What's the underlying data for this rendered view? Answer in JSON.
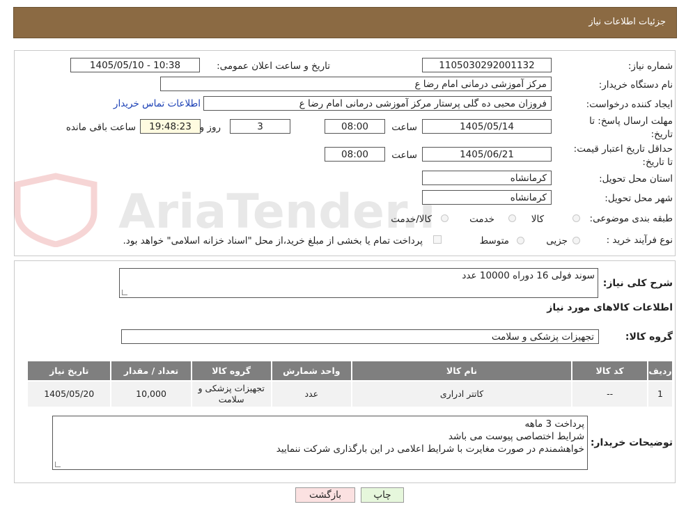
{
  "header": {
    "title": "جزئیات اطلاعات نیاز"
  },
  "form": {
    "need_number_label": "شماره نیاز:",
    "need_number": "1105030292001132",
    "announce_label": "تاریخ و ساعت اعلان عمومی:",
    "announce_value": "1405/05/10 - 10:38",
    "buyer_org_label": "نام دستگاه خریدار:",
    "buyer_org": "مرکز آموزشی  درمانی امام رضا  ع",
    "requester_label": "ایجاد کننده درخواست:",
    "requester": "فروزان محبی ده گلی پرستار مرکز آموزشی  درمانی امام رضا  ع",
    "contact_link": "اطلاعات تماس خریدار",
    "deadline_label": "مهلت ارسال پاسخ: تا تاریخ:",
    "deadline_date": "1405/05/14",
    "time_label": "ساعت",
    "deadline_time": "08:00",
    "days_value": "3",
    "days_label": "روز و",
    "remaining_time": "19:48:23",
    "remaining_label": "ساعت باقی مانده",
    "validity_label": "حداقل تاریخ اعتبار قیمت: تا تاریخ:",
    "validity_date": "1405/06/21",
    "validity_time": "08:00",
    "province_label": "استان محل تحویل:",
    "province": "کرمانشاه",
    "city_label": "شهر محل تحویل:",
    "city": "کرمانشاه",
    "category_label": "طبقه بندی موضوعی:",
    "category_options": [
      "کالا",
      "خدمت",
      "کالا/خدمت"
    ],
    "process_label": "نوع فرآیند خرید :",
    "process_options": [
      "جزیی",
      "متوسط"
    ],
    "payment_note": "پرداخت تمام یا بخشی از مبلغ خرید،از محل \"اسناد خزانه اسلامی\" خواهد بود."
  },
  "summary": {
    "description_label": "شرح کلی نیاز:",
    "description": "سوند فولی 16 دوراه 10000 عدد",
    "goods_info_title": "اطلاعات کالاهای مورد نیاز",
    "goods_group_label": "گروه کالا:",
    "goods_group": "تجهیزات پزشکی و سلامت"
  },
  "table": {
    "headers": [
      "ردیف",
      "کد کالا",
      "نام کالا",
      "واحد شمارش",
      "گروه کالا",
      "تعداد / مقدار",
      "تاریخ نیاز"
    ],
    "rows": [
      [
        "1",
        "--",
        "کاتتر ادراری",
        "عدد",
        "تجهیزات پزشکی و سلامت",
        "10,000",
        "1405/05/20"
      ]
    ]
  },
  "buyer_notes": {
    "label": "توضیحات خریدار:",
    "lines": [
      "پرداخت 3 ماهه",
      "شرایط اختصاصی پیوست می باشد",
      "خواهشمندم  در صورت مغایرت با شرایط اعلامی در این بارگذاری شرکت ننمایید"
    ]
  },
  "buttons": {
    "print": "چاپ",
    "back": "بازگشت"
  },
  "watermark": {
    "text": "AriaTender.neT"
  },
  "colors": {
    "header_bg": "#8b6a43",
    "table_header_bg": "#7f7f7f",
    "link": "#1a3fb5",
    "print_btn_bg": "#e6f7dc",
    "back_btn_bg": "#fbe1e1",
    "yellow_box": "#fffbe0"
  }
}
